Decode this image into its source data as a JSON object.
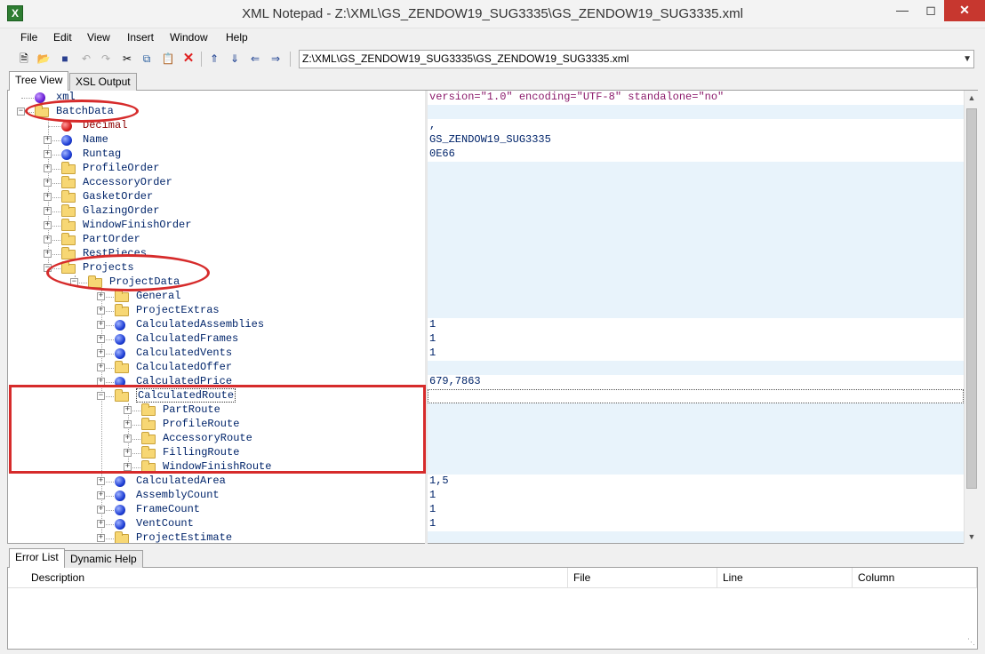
{
  "window": {
    "app_icon": "X",
    "title": "XML Notepad - Z:\\XML\\GS_ZENDOW19_SUG3335\\GS_ZENDOW19_SUG3335.xml"
  },
  "menu": [
    "File",
    "Edit",
    "View",
    "Insert",
    "Window",
    "Help"
  ],
  "toolbar": {
    "buttons": [
      "new-icon",
      "open-icon",
      "save-icon",
      "undo-icon",
      "redo-icon",
      "cut-icon",
      "copy-icon",
      "paste-icon",
      "delete-icon",
      "nudge-up-icon",
      "nudge-down-icon",
      "nudge-left-icon",
      "nudge-right-icon"
    ],
    "path": "Z:\\XML\\GS_ZENDOW19_SUG3335\\GS_ZENDOW19_SUG3335.xml"
  },
  "top_tabs": [
    "Tree View",
    "XSL Output"
  ],
  "tree": [
    {
      "label": "xml",
      "icon": "purple-ball",
      "depth": 0,
      "exp": "",
      "value": "version=\"1.0\" encoding=\"UTF-8\" standalone=\"no\"",
      "decl": true
    },
    {
      "label": "BatchData",
      "icon": "folder",
      "depth": 0,
      "exp": "−",
      "value": ""
    },
    {
      "label": "Decimal",
      "icon": "red-ball",
      "depth": 1,
      "exp": "",
      "value": ","
    },
    {
      "label": "Name",
      "icon": "blue-ball",
      "depth": 1,
      "exp": "+",
      "value": "GS_ZENDOW19_SUG3335"
    },
    {
      "label": "Runtag",
      "icon": "blue-ball",
      "depth": 1,
      "exp": "+",
      "value": "0E66"
    },
    {
      "label": "ProfileOrder",
      "icon": "folder",
      "depth": 1,
      "exp": "+",
      "value": ""
    },
    {
      "label": "AccessoryOrder",
      "icon": "folder",
      "depth": 1,
      "exp": "+",
      "value": ""
    },
    {
      "label": "GasketOrder",
      "icon": "folder",
      "depth": 1,
      "exp": "+",
      "value": ""
    },
    {
      "label": "GlazingOrder",
      "icon": "folder",
      "depth": 1,
      "exp": "+",
      "value": ""
    },
    {
      "label": "WindowFinishOrder",
      "icon": "folder",
      "depth": 1,
      "exp": "+",
      "value": ""
    },
    {
      "label": "PartOrder",
      "icon": "folder",
      "depth": 1,
      "exp": "+",
      "value": ""
    },
    {
      "label": "RestPieces",
      "icon": "folder",
      "depth": 1,
      "exp": "+",
      "value": ""
    },
    {
      "label": "Projects",
      "icon": "folder",
      "depth": 1,
      "exp": "−",
      "value": ""
    },
    {
      "label": "ProjectData",
      "icon": "folder",
      "depth": 2,
      "exp": "−",
      "value": ""
    },
    {
      "label": "General",
      "icon": "folder",
      "depth": 3,
      "exp": "+",
      "value": ""
    },
    {
      "label": "ProjectExtras",
      "icon": "folder",
      "depth": 3,
      "exp": "+",
      "value": ""
    },
    {
      "label": "CalculatedAssemblies",
      "icon": "blue-ball",
      "depth": 3,
      "exp": "+",
      "value": "1"
    },
    {
      "label": "CalculatedFrames",
      "icon": "blue-ball",
      "depth": 3,
      "exp": "+",
      "value": "1"
    },
    {
      "label": "CalculatedVents",
      "icon": "blue-ball",
      "depth": 3,
      "exp": "+",
      "value": "1"
    },
    {
      "label": "CalculatedOffer",
      "icon": "folder",
      "depth": 3,
      "exp": "+",
      "value": ""
    },
    {
      "label": "CalculatedPrice",
      "icon": "blue-ball",
      "depth": 3,
      "exp": "+",
      "value": "679,7863"
    },
    {
      "label": "CalculatedRoute",
      "icon": "folder",
      "depth": 3,
      "exp": "−",
      "value": "",
      "selected": true
    },
    {
      "label": "PartRoute",
      "icon": "folder",
      "depth": 4,
      "exp": "+",
      "value": ""
    },
    {
      "label": "ProfileRoute",
      "icon": "folder",
      "depth": 4,
      "exp": "+",
      "value": ""
    },
    {
      "label": "AccessoryRoute",
      "icon": "folder",
      "depth": 4,
      "exp": "+",
      "value": ""
    },
    {
      "label": "FillingRoute",
      "icon": "folder",
      "depth": 4,
      "exp": "+",
      "value": ""
    },
    {
      "label": "WindowFinishRoute",
      "icon": "folder",
      "depth": 4,
      "exp": "+",
      "value": ""
    },
    {
      "label": "CalculatedArea",
      "icon": "blue-ball",
      "depth": 3,
      "exp": "+",
      "value": "1,5"
    },
    {
      "label": "AssemblyCount",
      "icon": "blue-ball",
      "depth": 3,
      "exp": "+",
      "value": "1"
    },
    {
      "label": "FrameCount",
      "icon": "blue-ball",
      "depth": 3,
      "exp": "+",
      "value": "1"
    },
    {
      "label": "VentCount",
      "icon": "blue-ball",
      "depth": 3,
      "exp": "+",
      "value": "1"
    },
    {
      "label": "ProjectEstimate",
      "icon": "folder",
      "depth": 3,
      "exp": "+",
      "value": ""
    }
  ],
  "bottom_tabs": [
    "Error List",
    "Dynamic Help"
  ],
  "error_list": {
    "columns": [
      "Description",
      "File",
      "Line",
      "Column"
    ]
  },
  "colors": {
    "annotation": "#d62b2b",
    "node_text": "#00246a",
    "value_tint": "#e8f3fb"
  }
}
